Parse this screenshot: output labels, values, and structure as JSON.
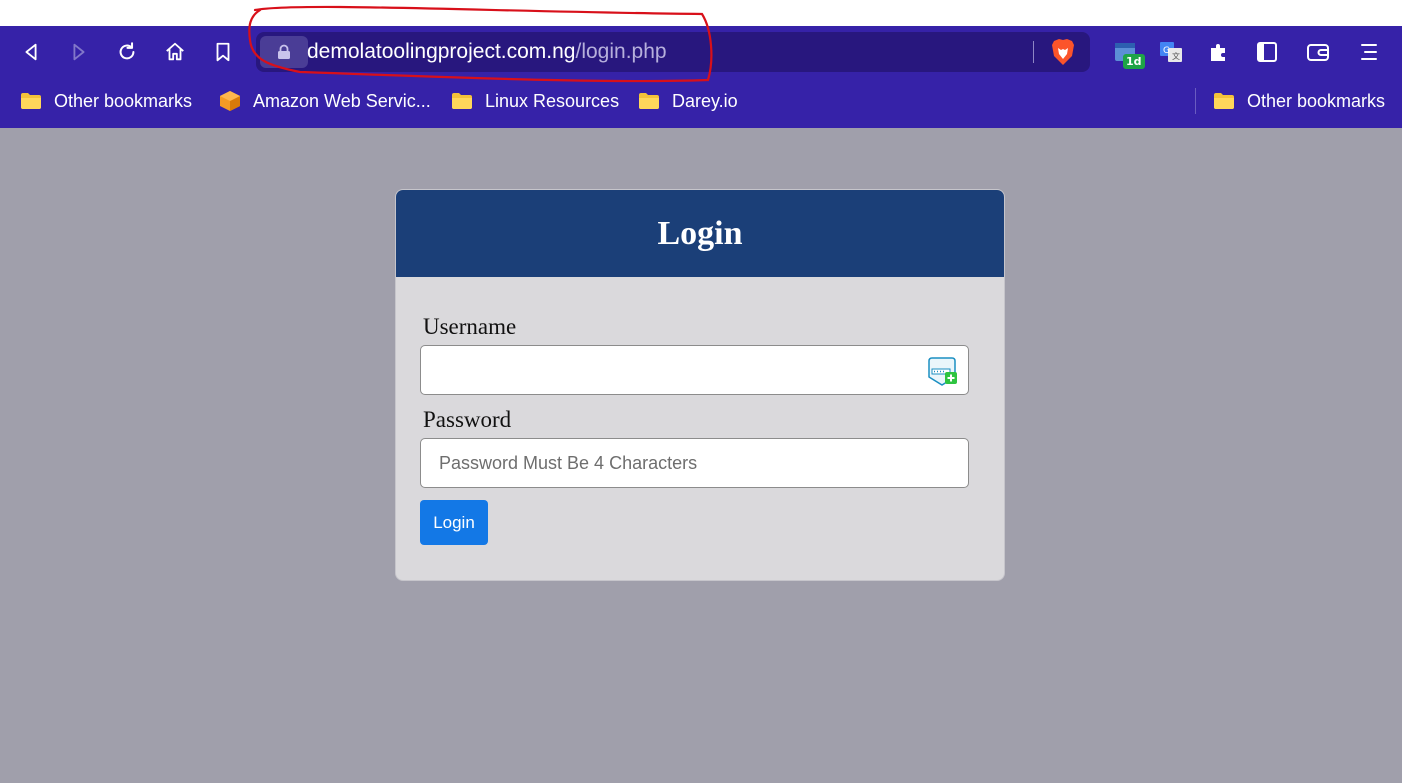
{
  "browser": {
    "url": {
      "host": "demolatoolingproject.com.ng",
      "path": "/login.php"
    },
    "nav": {
      "back_icon": "back-arrow-icon",
      "forward_icon": "forward-arrow-icon",
      "reload_icon": "reload-icon",
      "home_icon": "home-icon",
      "bookmark_icon": "bookmark-icon"
    },
    "extensions": {
      "calendar_badge": "1d",
      "translate_icon": "google-translate-icon",
      "puzzle_icon": "extensions-puzzle-icon",
      "sidebar_icon": "sidebar-icon",
      "wallet_icon": "wallet-icon",
      "menu_icon": "menu-icon"
    },
    "bookmarks": [
      {
        "label": "Other bookmarks",
        "icon": "folder-icon"
      },
      {
        "label": "Amazon Web Servic...",
        "icon": "aws-cube-icon"
      },
      {
        "label": "Linux Resources",
        "icon": "folder-icon"
      },
      {
        "label": "Darey.io",
        "icon": "folder-icon"
      }
    ],
    "bookmarks_right": {
      "label": "Other bookmarks",
      "icon": "folder-icon"
    }
  },
  "login": {
    "title": "Login",
    "username_label": "Username",
    "username_value": "",
    "password_label": "Password",
    "password_placeholder": "Password Must Be 4 Characters",
    "submit_label": "Login"
  },
  "colors": {
    "browser_chrome": "#3622a8",
    "page_background": "#a09fab",
    "card_header": "#1b3f78",
    "button": "#1378e6",
    "annotation": "#d8101a"
  }
}
